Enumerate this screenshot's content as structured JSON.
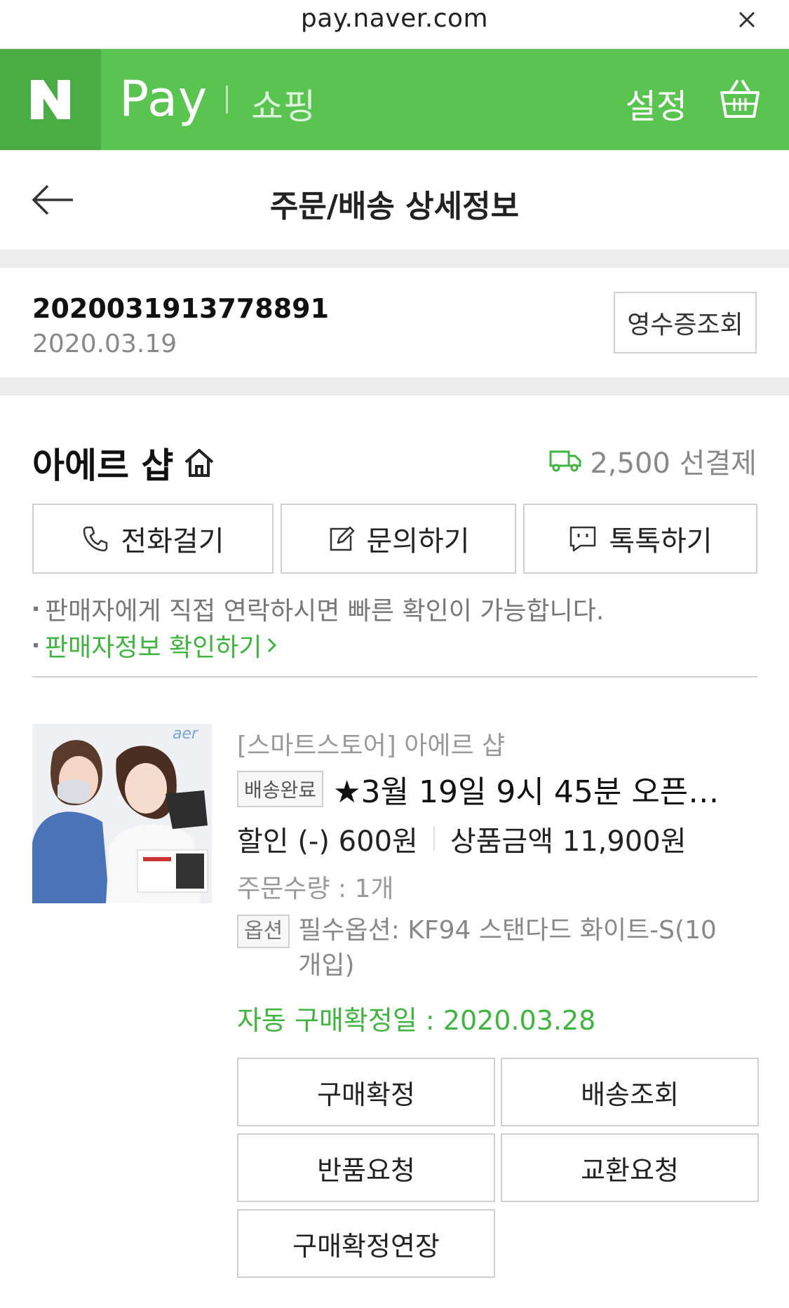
{
  "urlbar": {
    "url": "pay.naver.com"
  },
  "header": {
    "logo": "N",
    "brand": "Pay",
    "section": "쇼핑",
    "settings": "설정"
  },
  "titlebar": {
    "title": "주문/배송 상세정보"
  },
  "order": {
    "number": "2020031913778891",
    "date": "2020.03.19",
    "receipt_button": "영수증조회"
  },
  "seller": {
    "name": "아에르 샵",
    "shipping_fee": "2,500 선결제",
    "buttons": {
      "call": "전화걸기",
      "inquiry": "문의하기",
      "talk": "톡톡하기"
    },
    "note": "판매자에게 직접 연락하시면 빠른 확인이 가능합니다.",
    "seller_info_link": "판매자정보 확인하기"
  },
  "product": {
    "image_logo": "aer",
    "store": "[스마트스토어] 아에르 샵",
    "status_badge": "배송완료",
    "name": "★3월 19일 9시 45분 오픈…",
    "discount": "할인 (-) 600원",
    "price": "상품금액 11,900원",
    "quantity": "주문수량 : 1개",
    "option_badge": "옵션",
    "option_text": "필수옵션: KF94 스탠다드 화이트-S(10개입)",
    "auto_confirm": "자동 구매확정일 : 2020.03.28"
  },
  "actions": {
    "confirm": "구매확정",
    "track": "배송조회",
    "return": "반품요청",
    "exchange": "교환요청",
    "extend": "구매확정연장"
  },
  "colors": {
    "naver_green": "#5ac451",
    "logo_green": "#4aad43",
    "accent_text_green": "#3fb53f"
  }
}
